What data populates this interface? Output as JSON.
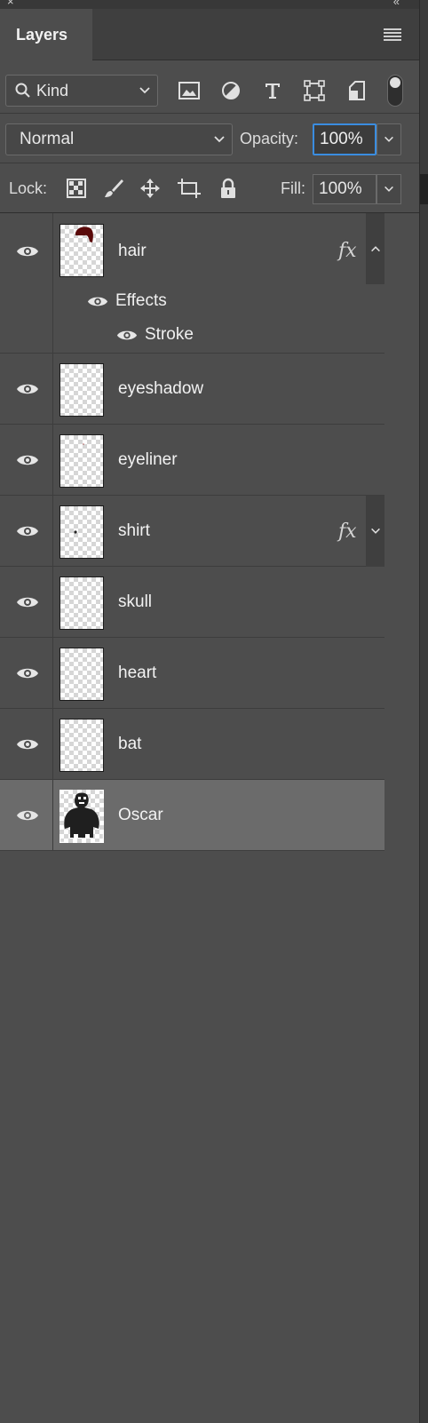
{
  "panel": {
    "title": "Layers"
  },
  "filter": {
    "label": "Kind",
    "icons": [
      "image-filter-icon",
      "adjustment-filter-icon",
      "type-filter-icon",
      "shape-filter-icon",
      "smart-object-filter-icon"
    ]
  },
  "blend": {
    "mode": "Normal",
    "opacity_label": "Opacity:",
    "opacity_value": "100%"
  },
  "lock": {
    "label": "Lock:",
    "fill_label": "Fill:",
    "fill_value": "100%"
  },
  "layers": [
    {
      "name": "hair",
      "fx": "fx",
      "effects_label": "Effects",
      "stroke_label": "Stroke"
    },
    {
      "name": "eyeshadow"
    },
    {
      "name": "eyeliner"
    },
    {
      "name": "shirt",
      "fx": "fx"
    },
    {
      "name": "skull"
    },
    {
      "name": "heart"
    },
    {
      "name": "bat"
    },
    {
      "name": "Oscar",
      "selected": true
    }
  ]
}
